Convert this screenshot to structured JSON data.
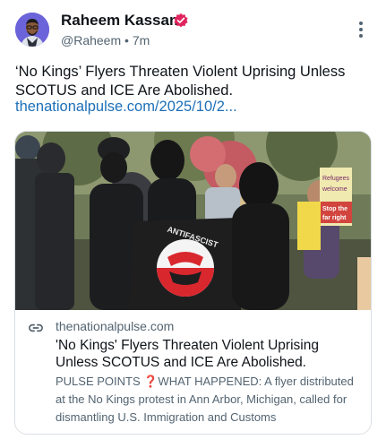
{
  "author": {
    "name": "Raheem Kassam",
    "handle": "@Raheem",
    "separator": "•",
    "time": "7m",
    "verified": true
  },
  "post": {
    "text": "‘No Kings’ Flyers Threaten Violent Uprising Unless SCOTUS and ICE Are Abolished.",
    "link": "thenationalpulse.com/2025/10/2..."
  },
  "card": {
    "domain": "thenationalpulse.com",
    "title": "'No Kings' Flyers Threaten Violent Uprising Unless SCOTUS and ICE Are Abolished.",
    "description": "PULSE POINTS ❓WHAT HAPPENED: A flyer distributed at the No Kings protest in Ann Arbor, Michigan, called for dismantling U.S. Immigration and Customs",
    "image_sign_text": [
      "Refugees",
      "welcome",
      "Stop the",
      "far right"
    ],
    "image_flag_text": "ANTIFASCIST"
  },
  "colors": {
    "link": "#1d6fb8",
    "verified_badge": "#e0245e",
    "avatar_bg": "#6b63d9",
    "secondary_text": "#536471"
  },
  "icons": {
    "verified": "verified-badge-icon",
    "more": "more-vertical-icon",
    "link": "link-icon"
  }
}
